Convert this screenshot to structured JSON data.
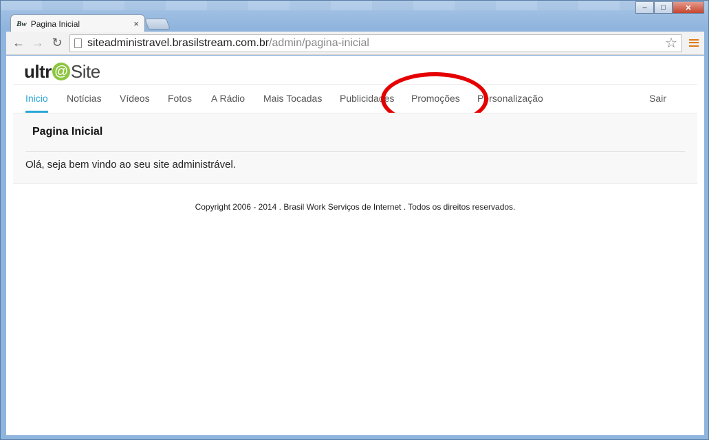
{
  "browser": {
    "tab_title": "Pagina Inicial",
    "tab_favicon": "Bw",
    "tab_close": "×",
    "url_host": "siteadministravel.brasilstream.com.br",
    "url_path": "/admin/pagina-inicial",
    "window_buttons": {
      "minimize": "–",
      "maximize": "□",
      "close": "✕"
    }
  },
  "site": {
    "logo": {
      "part1": "ultr",
      "at": "@",
      "part2": "Site"
    },
    "nav": [
      {
        "label": "Inicio",
        "active": true
      },
      {
        "label": "Notícias",
        "active": false
      },
      {
        "label": "Vídeos",
        "active": false
      },
      {
        "label": "Fotos",
        "active": false
      },
      {
        "label": "A Rádio",
        "active": false
      },
      {
        "label": "Mais Tocadas",
        "active": false
      },
      {
        "label": "Publicidades",
        "active": false
      },
      {
        "label": "Promoções",
        "active": false
      },
      {
        "label": "Personalização",
        "active": false
      },
      {
        "label": "Sair",
        "active": false
      }
    ],
    "panel": {
      "title": "Pagina Inicial",
      "text": "Olá, seja bem vindo ao seu site administrável."
    },
    "footer": "Copyright 2006 - 2014 . Brasil Work Serviços de Internet . Todos os direitos reservados."
  },
  "colors": {
    "accent": "#2aa6d6",
    "logo_green": "#8cc63f",
    "annotation": "#e50000"
  }
}
